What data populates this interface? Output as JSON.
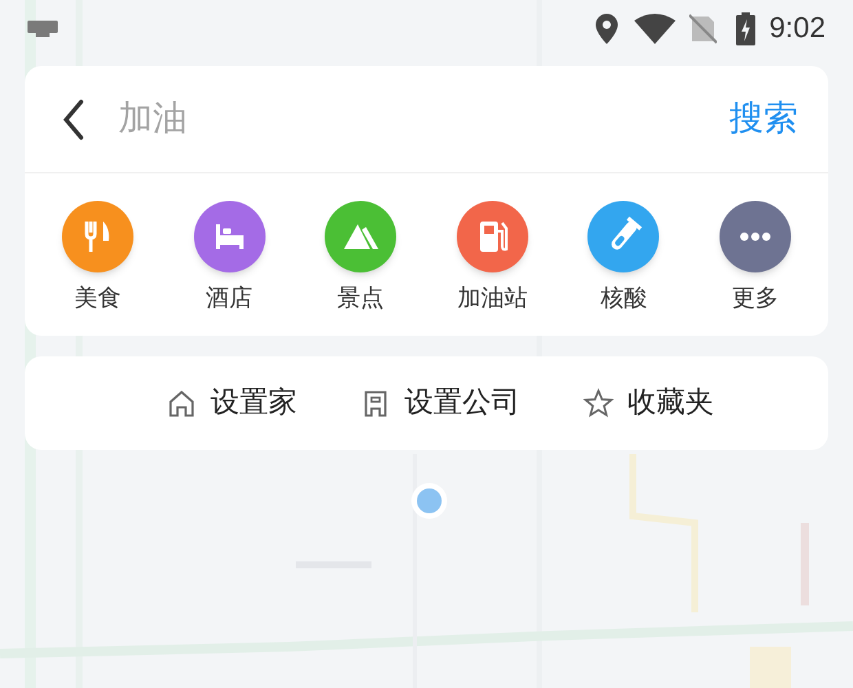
{
  "status_bar": {
    "time": "9:02"
  },
  "search": {
    "placeholder": "加油",
    "button": "搜索"
  },
  "categories": [
    {
      "label": "美食",
      "kind": "food",
      "color": "#f7901e"
    },
    {
      "label": "酒店",
      "kind": "hotel",
      "color": "#a46be6"
    },
    {
      "label": "景点",
      "kind": "scenic",
      "color": "#4bbf35"
    },
    {
      "label": "加油站",
      "kind": "fuel",
      "color": "#f2664a"
    },
    {
      "label": "核酸",
      "kind": "test",
      "color": "#33a6ef"
    },
    {
      "label": "更多",
      "kind": "more",
      "color": "#6e7392"
    }
  ],
  "shortcuts": [
    {
      "label": "设置家",
      "kind": "home"
    },
    {
      "label": "设置公司",
      "kind": "office"
    },
    {
      "label": "收藏夹",
      "kind": "star"
    }
  ]
}
